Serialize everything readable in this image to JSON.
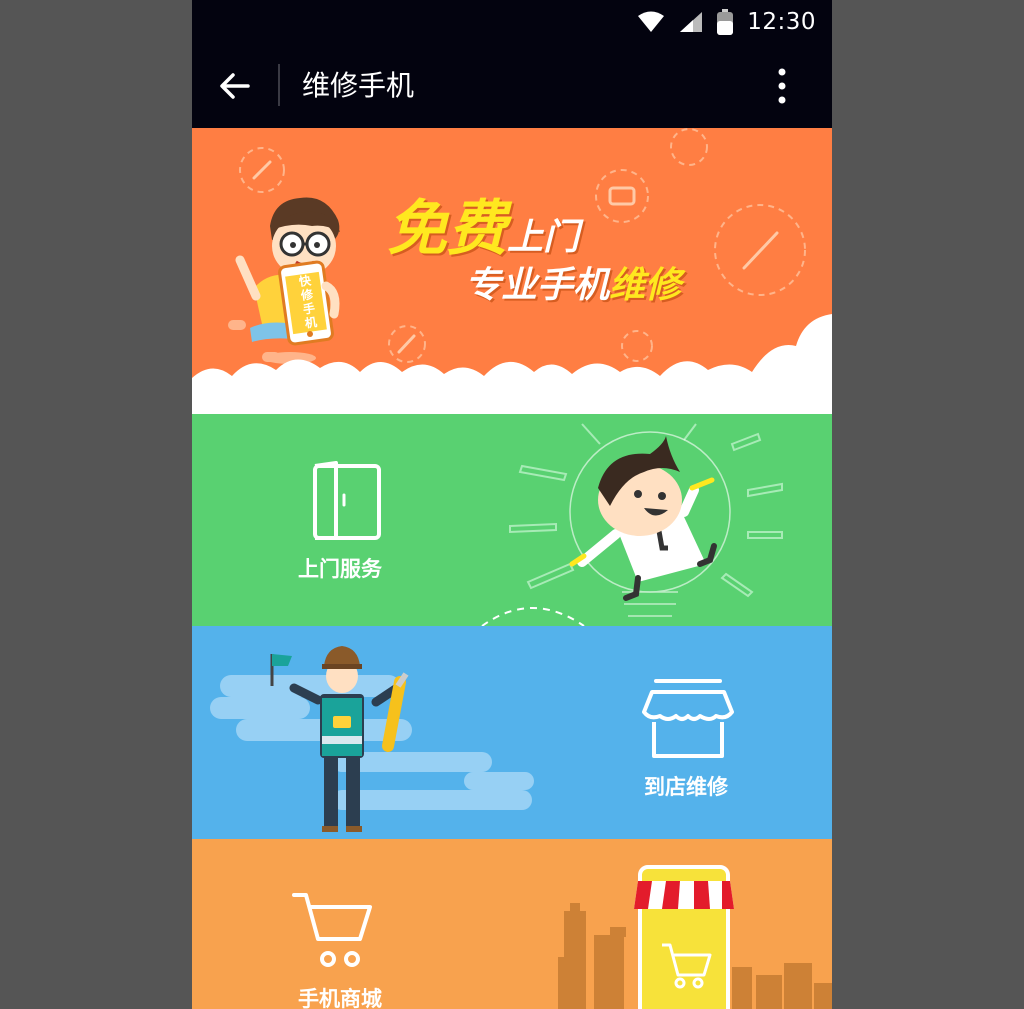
{
  "status_bar": {
    "time": "12:30",
    "icons": [
      "wifi-icon",
      "cell-signal-icon",
      "battery-icon"
    ]
  },
  "toolbar": {
    "title": "维修手机",
    "back_icon": "arrow-left-icon",
    "overflow_icon": "more-vertical-icon"
  },
  "banner": {
    "line1_emphasis": "免费",
    "line1_rest": "上门",
    "line2_white": "专业手机",
    "line2_yellow": "维修",
    "phone_text": "快修手机",
    "bg_color": "#ff7e43"
  },
  "tiles": [
    {
      "label": "上门服务",
      "icon": "door-icon",
      "bg_color": "#59d171"
    },
    {
      "label": "到店维修",
      "icon": "storefront-icon",
      "bg_color": "#54b2eb"
    },
    {
      "label": "手机商城",
      "icon": "shopping-cart-icon",
      "bg_color": "#f8a24e"
    }
  ],
  "colors": {
    "status_bar": "#03030f",
    "accent_yellow": "#ffe81f"
  }
}
